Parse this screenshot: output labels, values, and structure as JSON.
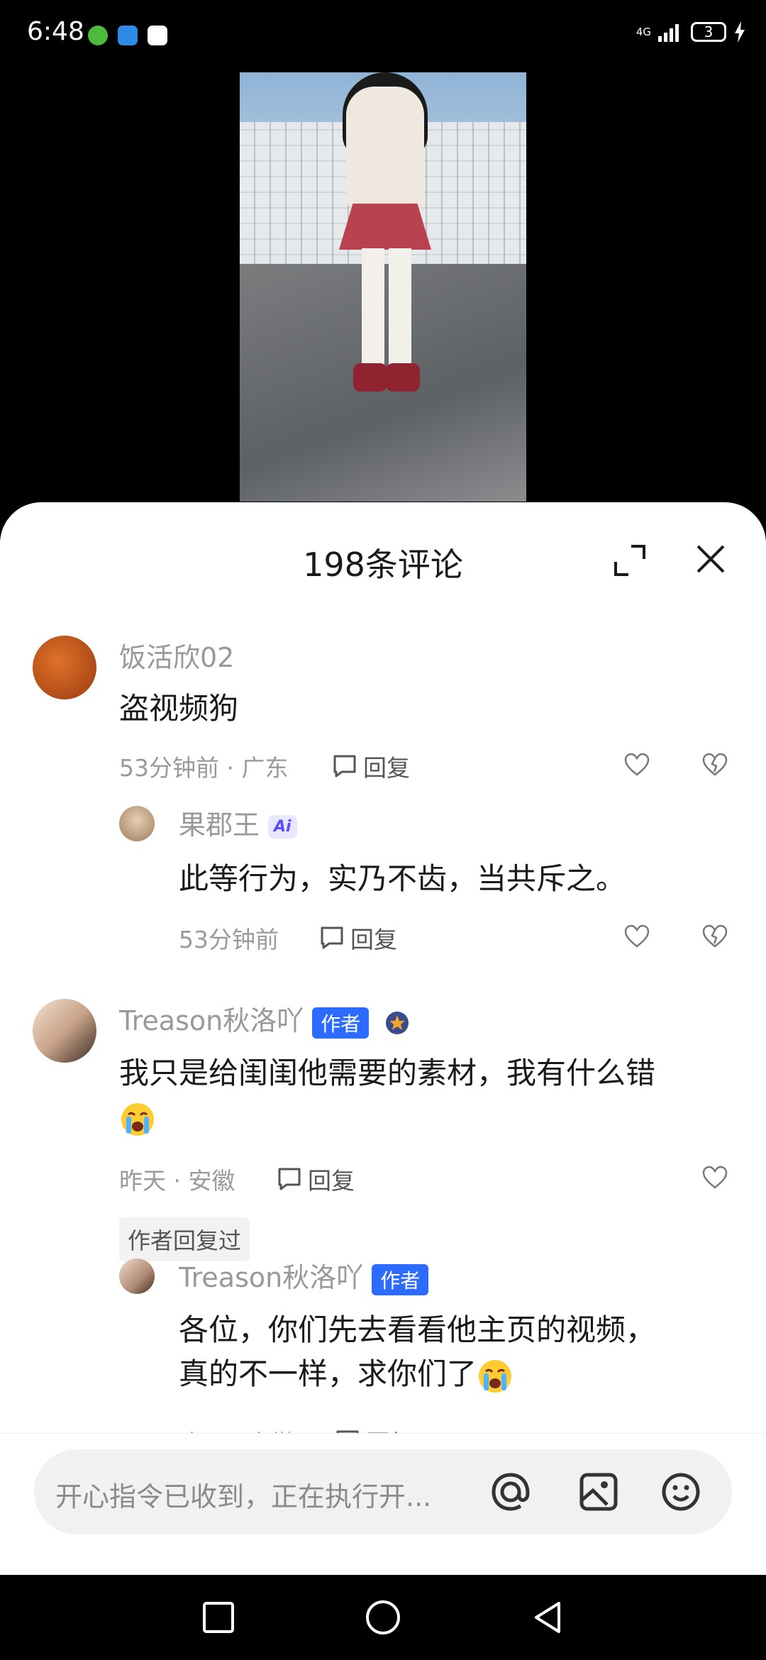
{
  "status_bar": {
    "time": "6:48",
    "network": "4G",
    "battery": "3",
    "app_icons": [
      "settings-app-icon",
      "browser-app-icon",
      "baidu-app-icon"
    ]
  },
  "video": {
    "description_icon": "video-frame"
  },
  "sheet": {
    "title": "198条评论",
    "expand_icon": "expand-icon",
    "close_icon": "close-icon"
  },
  "comments": [
    {
      "username": "饭活欣02",
      "text": "盗视频狗",
      "meta": "53分钟前 · 广东",
      "reply_label": "回复",
      "replies": [
        {
          "username": "果郡王",
          "badge": "Ai",
          "text": "此等行为，实乃不齿，当共斥之。",
          "meta": "53分钟前",
          "reply_label": "回复"
        }
      ]
    },
    {
      "username": "Treason秋洛吖",
      "badge": "作者",
      "text": "我只是给闺闺他需要的素材，我有什么错",
      "meta": "昨天 · 安徽",
      "reply_label": "回复",
      "author_replied": "作者回复过",
      "replies": [
        {
          "username": "Treason秋洛吖",
          "badge": "作者",
          "text_line1": "各位，你们先去看看他主页的视频，",
          "text_line2": "真的不一样，求你们了",
          "meta": "昨天 · 安徽",
          "reply_label": "回复"
        }
      ]
    }
  ],
  "input": {
    "placeholder": "开心指令已收到，正在执行开..."
  },
  "colors": {
    "author_badge": "#2d6bff",
    "ai_badge_bg": "#e9e6ff"
  }
}
